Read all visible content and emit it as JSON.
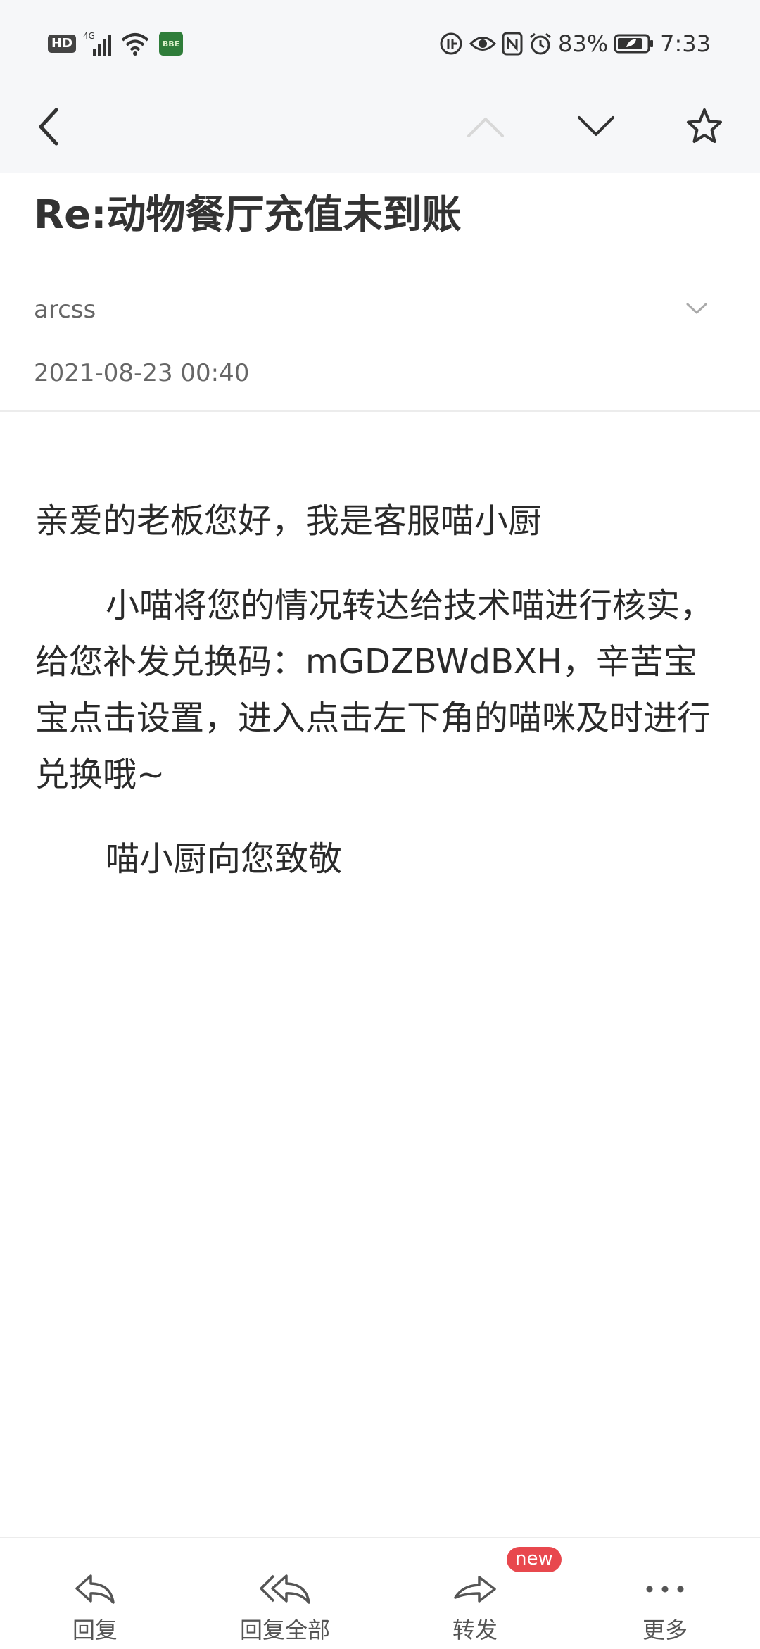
{
  "status_bar": {
    "hd": "HD",
    "network": "4G",
    "app_badge": "BBE",
    "battery": "83%",
    "time": "7:33"
  },
  "email": {
    "subject": "Re:动物餐厅充值未到账",
    "sender": "arcss",
    "date": "2021-08-23 00:40",
    "body": {
      "greeting": "亲爱的老板您好，我是客服喵小厨",
      "paragraph": "小喵将您的情况转达给技术喵进行核实，给您补发兑换码：mGDZBWdBXH，辛苦宝宝点击设置，进入点击左下角的喵咪及时进行兑换哦~",
      "signoff": "喵小厨向您致敬"
    }
  },
  "actions": {
    "reply": "回复",
    "reply_all": "回复全部",
    "forward": "转发",
    "forward_badge": "new",
    "more": "更多"
  },
  "colors": {
    "header_bg": "#f6f7f9",
    "badge_red": "#e8484e",
    "text_dark": "#333333",
    "text_gray": "#666666"
  }
}
